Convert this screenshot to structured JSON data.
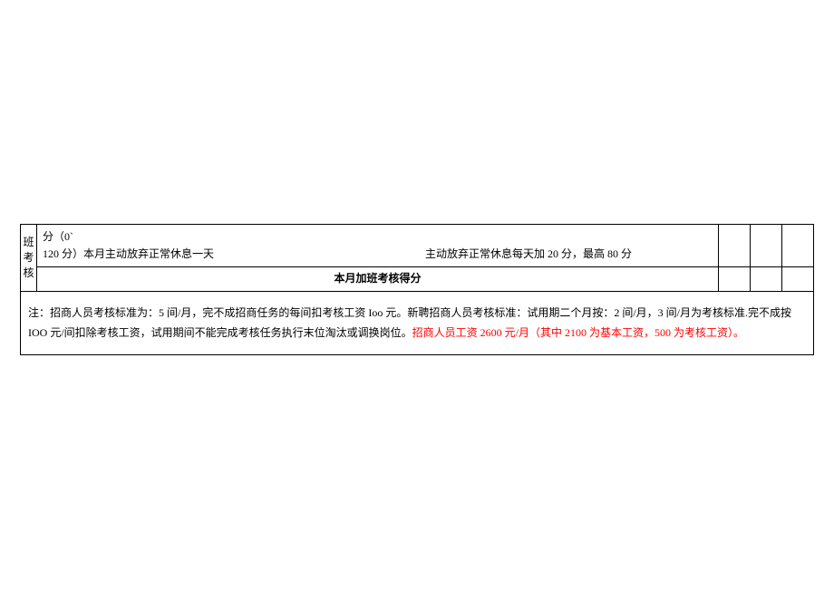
{
  "row1": {
    "header": "班考核",
    "line1": "分（0`",
    "line2_part1": "120 分）本月主动放弃正常休息一天",
    "line2_part2": "主动放弃正常休息每天加 20 分，最高 80 分"
  },
  "row2": {
    "title": "本月加班考核得分"
  },
  "note": {
    "prefix": "注：招商人员考核标准为：5 间/月，完不成招商任务的每间扣考核工资 Ioo 元。新聘招商人员考核标准：试用期二个月按：2 间/月，3 间/月为考核标准.完不成按 IOO 元/间扣除考核工资，试用期间不能完成考核任务执行末位淘汰或调换岗位。",
    "highlight": "招商人员工资 2600 元/月（其中 2100 为基本工资，500 为考核工资）。"
  }
}
